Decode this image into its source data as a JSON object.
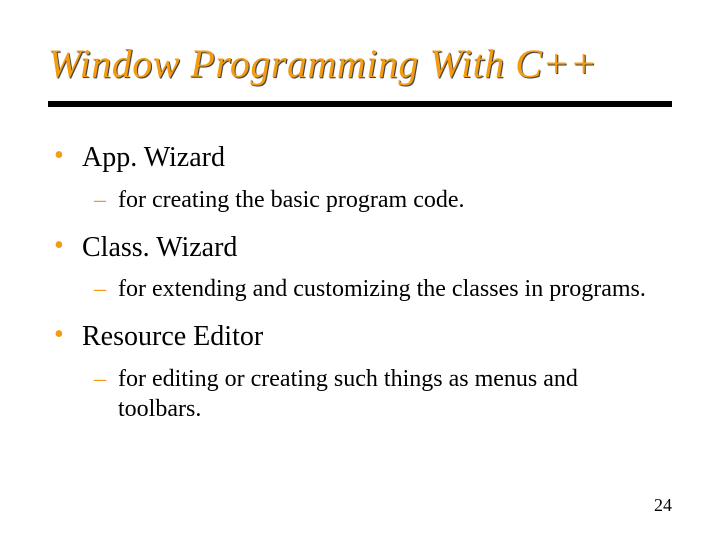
{
  "title": "Window Programming With C++",
  "items": [
    {
      "label": "App. Wizard",
      "sub": "for creating the basic program code."
    },
    {
      "label": "Class. Wizard",
      "sub": "for extending and customizing the classes in programs."
    },
    {
      "label": "Resource Editor",
      "sub": "for editing or creating such things as menus and toolbars."
    }
  ],
  "page_number": "24"
}
